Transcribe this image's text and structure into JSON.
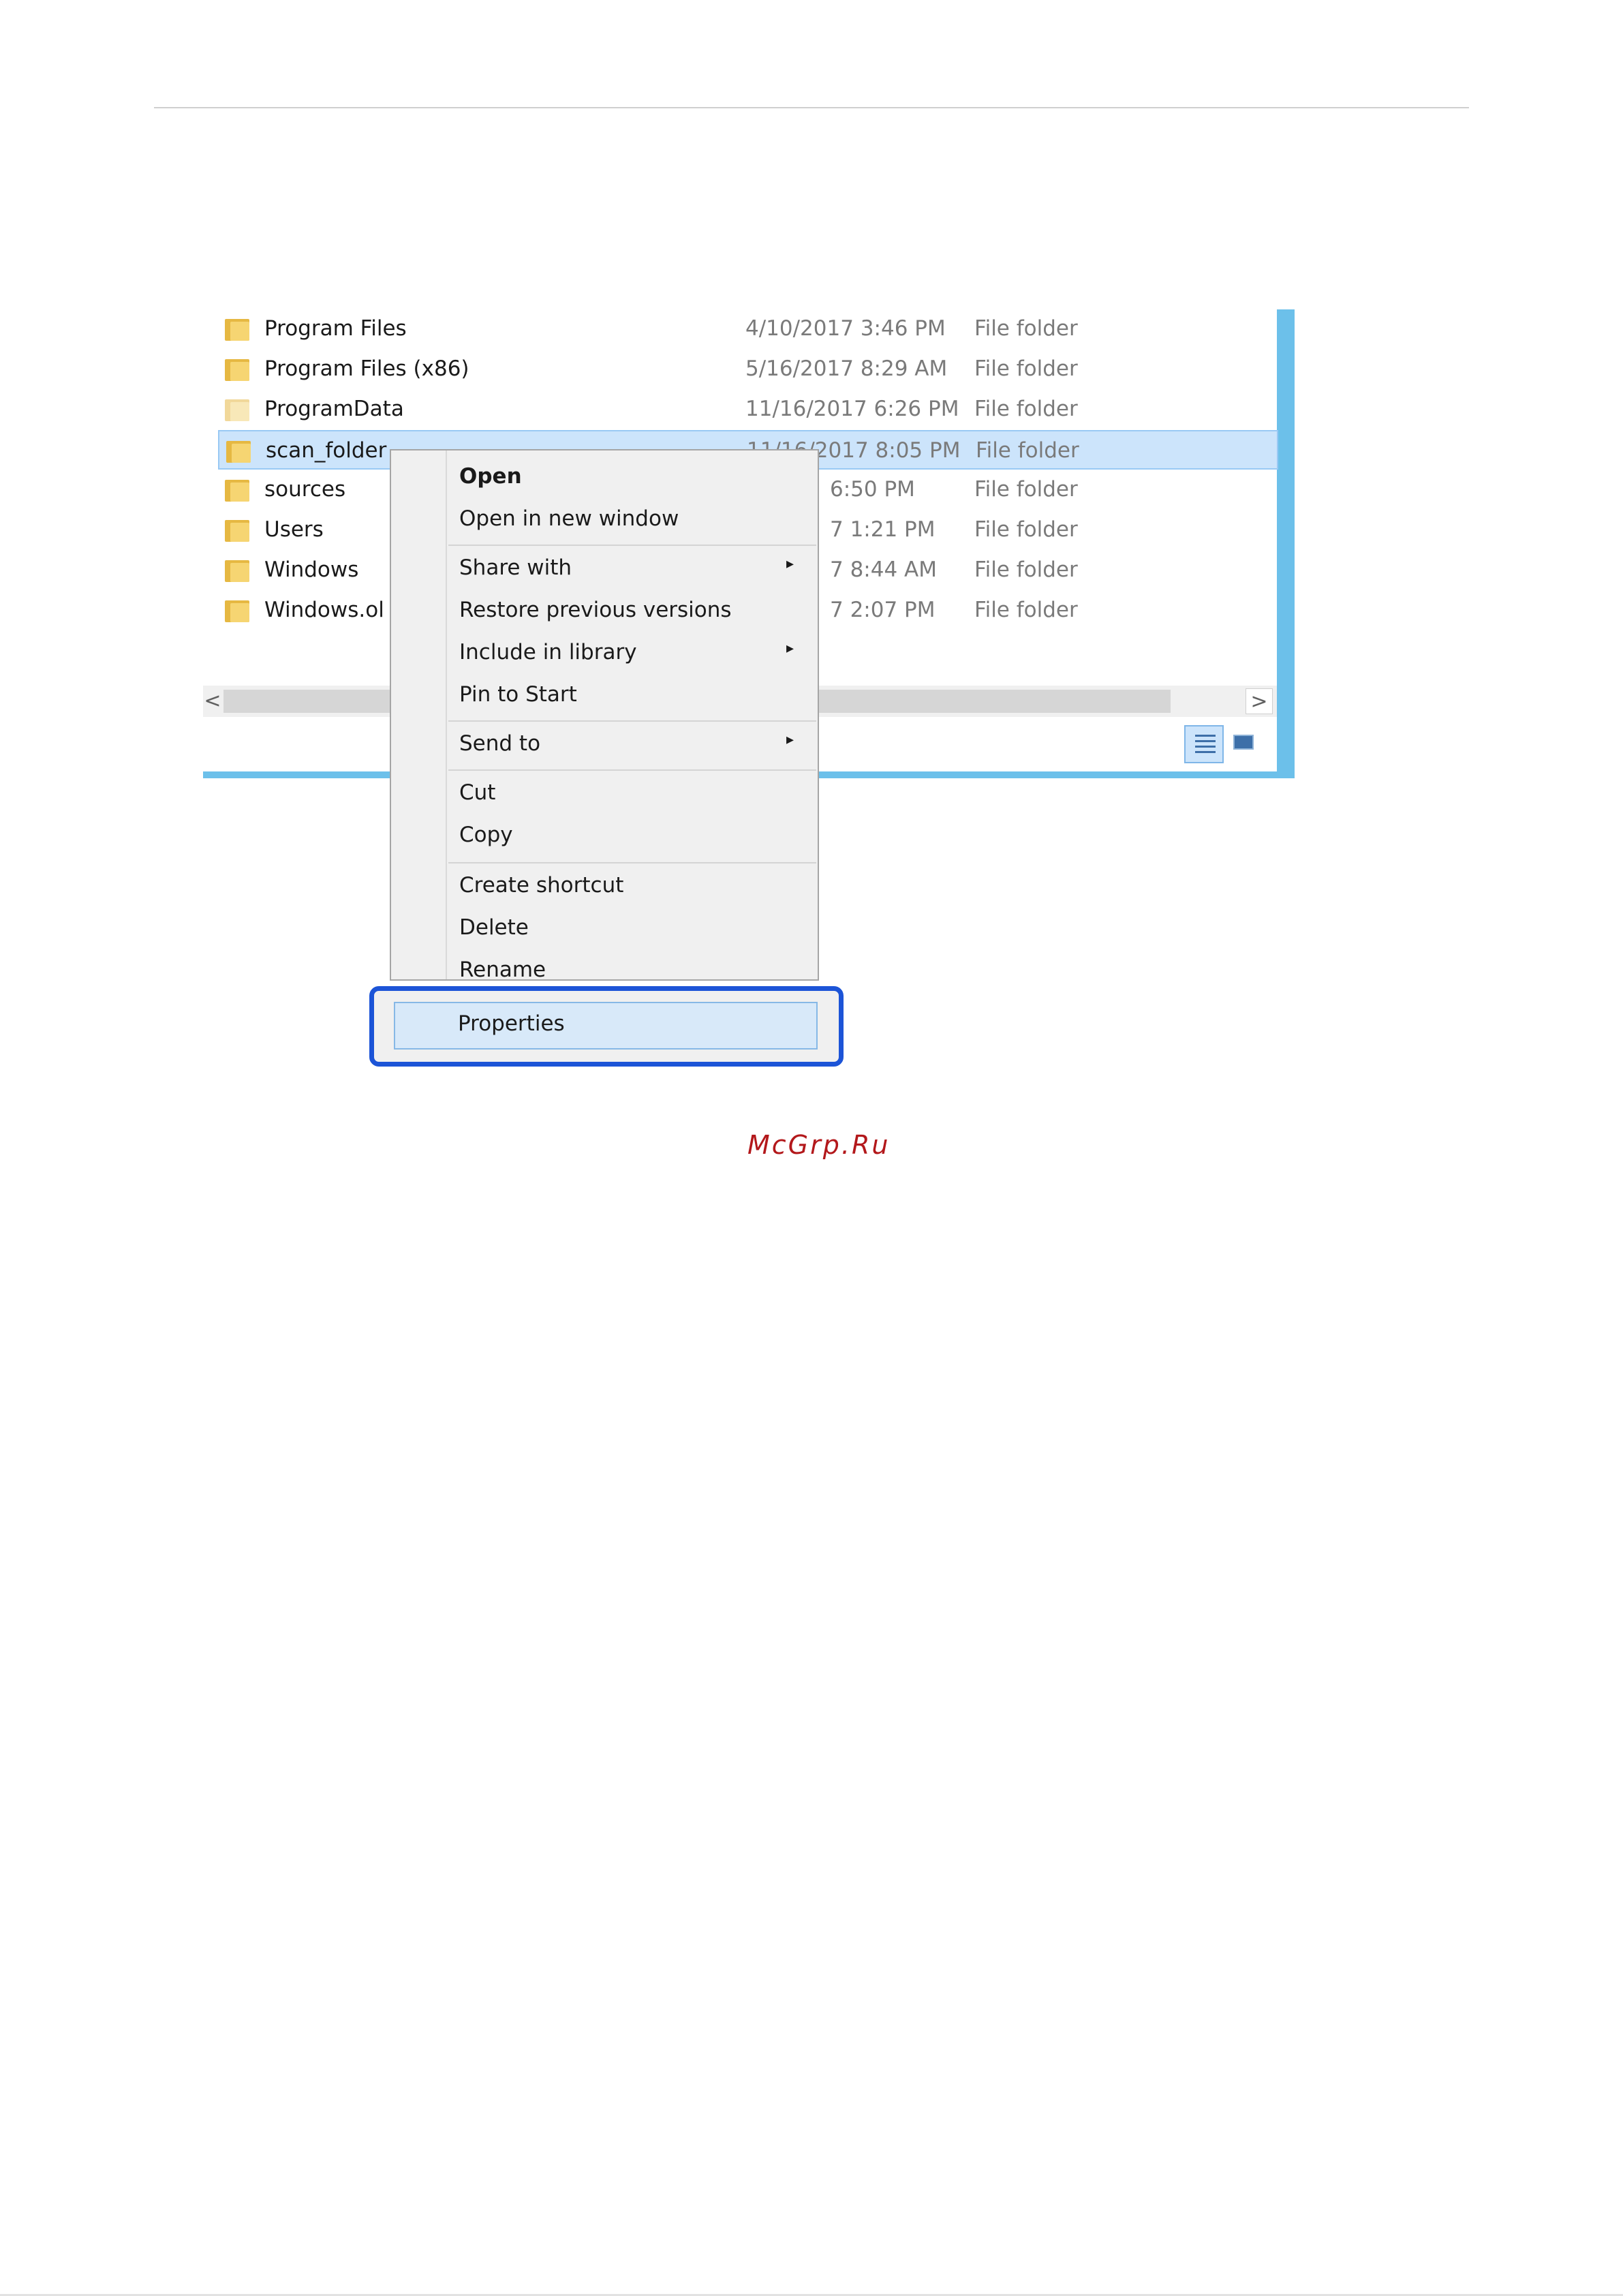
{
  "explorer": {
    "files": [
      {
        "name": "Program Files",
        "date": "4/10/2017 3:46 PM",
        "type": "File folder"
      },
      {
        "name": "Program Files (x86)",
        "date": "5/16/2017 8:29 AM",
        "type": "File folder"
      },
      {
        "name": "ProgramData",
        "date": "11/16/2017 6:26 PM",
        "type": "File folder"
      },
      {
        "name": "scan_folder",
        "date": "11/16/2017 8:05 PM",
        "type": "File folder"
      },
      {
        "name": "sources",
        "date": "6:50 PM",
        "type": "File folder"
      },
      {
        "name": "Users",
        "date": "7 1:21 PM",
        "type": "File folder"
      },
      {
        "name": "Windows",
        "date": "7 8:44 AM",
        "type": "File folder"
      },
      {
        "name": "Windows.ol",
        "date": "7 2:07 PM",
        "type": "File folder"
      }
    ],
    "selected_index": 3,
    "scroll_left_glyph": "<",
    "scroll_right_glyph": ">",
    "icons": {
      "folder": "folder-icon",
      "details_view": "details-view-icon",
      "large_icons_view": "large-icons-view-icon"
    }
  },
  "context_menu": {
    "items": {
      "open": "Open",
      "open_new_window": "Open in new window",
      "share_with": "Share with",
      "restore_previous": "Restore previous versions",
      "include_in_library": "Include in library",
      "pin_to_start": "Pin to Start",
      "send_to": "Send to",
      "cut": "Cut",
      "copy": "Copy",
      "create_shortcut": "Create shortcut",
      "delete": "Delete",
      "rename": "Rename",
      "properties": "Properties"
    },
    "submenu_glyph": "▸",
    "highlight_color": "#1c54d7"
  },
  "watermark": "McGrp.Ru"
}
